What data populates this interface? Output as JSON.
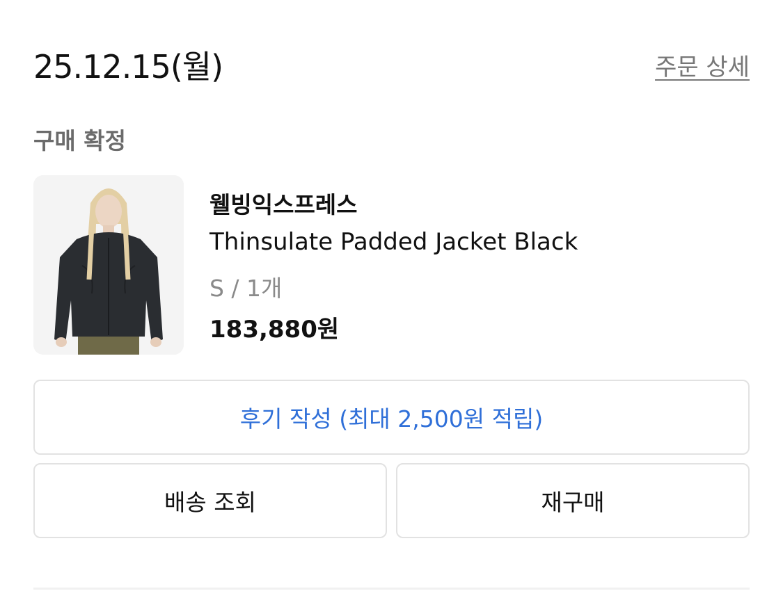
{
  "order": {
    "date": "25.12.15(월)",
    "detail_link": "주문 상세",
    "status": "구매 확정"
  },
  "product": {
    "brand": "웰빙익스프레스",
    "name": "Thinsulate Padded Jacket Black",
    "option": "S / 1개",
    "price": "183,880원"
  },
  "actions": {
    "review_label": "후기 작성 (최대 2,500원 적립)",
    "track_label": "배송 조회",
    "rebuy_label": "재구매"
  },
  "colors": {
    "review_accent": "#2f6fd8",
    "status_gray": "#6b6b6b",
    "border": "#e2e2e2"
  }
}
